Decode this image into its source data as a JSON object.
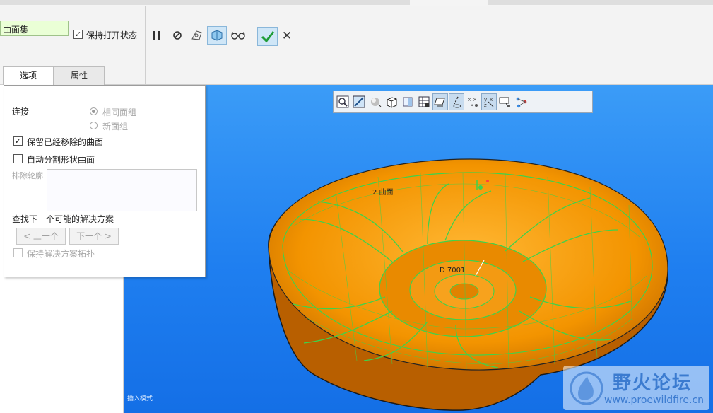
{
  "dashboard": {
    "collector_text": "曲面集",
    "keep_open_label": "保持打开状态",
    "keep_open_checked": true,
    "buttons": [
      "pause-icon",
      "stop-icon",
      "preview-icon",
      "verify-icon",
      "glasses-icon"
    ],
    "ok_icon": "checkmark-icon",
    "cancel_label": "✕",
    "tabs": {
      "options": "选项",
      "properties": "属性"
    }
  },
  "options_panel": {
    "connect_label": "连接",
    "radio_same_quilt": "相同面组",
    "radio_new_quilt": "新面组",
    "keep_removed_label": "保留已经移除的曲面",
    "keep_removed_checked": true,
    "auto_split_label": "自动分割形状曲面",
    "auto_split_checked": false,
    "exclude_label": "排除轮廓",
    "find_solution_label": "查找下一个可能的解决方案",
    "prev_button": "< 上一个",
    "next_button": "下一个 >",
    "keep_topology_label": "保持解决方案拓扑"
  },
  "viewport": {
    "annotation_surface": "2 曲面",
    "annotation_center": "D 7001",
    "status_text": "插入模式",
    "model_color": "#f79a00",
    "mesh_color": "#3fd24a"
  },
  "view_toolbar": [
    "zoom-icon",
    "repaint-icon",
    "shading-icon",
    "view-cube-icon",
    "saved-views-icon",
    "display-style-icon",
    "datum-plane-icon",
    "datum-axis-icon",
    "datum-point-icon",
    "csys-icon",
    "annotation-icon",
    "spin-center-icon"
  ],
  "watermark": {
    "title": "野火论坛",
    "url": "www.proewildfire.cn"
  }
}
